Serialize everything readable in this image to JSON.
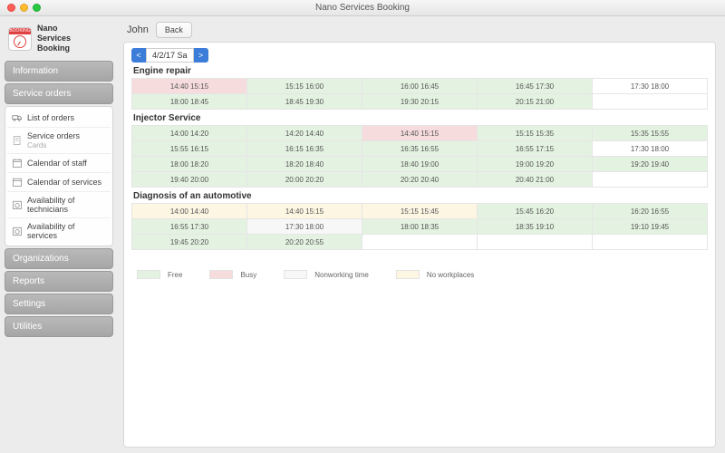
{
  "window": {
    "title": "Nano Services Booking"
  },
  "brand": {
    "line1": "Nano",
    "line2": "Services",
    "line3": "Booking",
    "logo_top": "BOOKING"
  },
  "sidebar": {
    "sections": [
      {
        "label": "Information"
      },
      {
        "label": "Service orders"
      },
      {
        "label": "Organizations"
      },
      {
        "label": "Reports"
      },
      {
        "label": "Settings"
      },
      {
        "label": "Utilities"
      }
    ],
    "sub": [
      {
        "label": "List of orders",
        "subtitle": ""
      },
      {
        "label": "Service orders",
        "subtitle": "Cards"
      },
      {
        "label": "Calendar of staff",
        "subtitle": ""
      },
      {
        "label": "Calendar of services",
        "subtitle": ""
      },
      {
        "label": "Availability of technicians",
        "subtitle": ""
      },
      {
        "label": "Availability of services",
        "subtitle": ""
      }
    ]
  },
  "header": {
    "name": "John",
    "back": "Back"
  },
  "datebar": {
    "prev": "<",
    "value": "4/2/17 Sa",
    "next": ">"
  },
  "groups": [
    {
      "title": "Engine repair",
      "rows": [
        [
          {
            "t": "14:40 15:15",
            "s": "busy"
          },
          {
            "t": "15:15 16:00",
            "s": "free"
          },
          {
            "t": "16:00 16:45",
            "s": "free"
          },
          {
            "t": "16:45 17:30",
            "s": "free"
          },
          {
            "t": "17:30 18:00",
            "s": "empty"
          }
        ],
        [
          {
            "t": "18:00 18:45",
            "s": "free"
          },
          {
            "t": "18:45 19:30",
            "s": "free"
          },
          {
            "t": "19:30 20:15",
            "s": "free"
          },
          {
            "t": "20:15 21:00",
            "s": "free"
          },
          {
            "t": "",
            "s": "empty"
          }
        ]
      ]
    },
    {
      "title": "Injector Service",
      "rows": [
        [
          {
            "t": "14:00 14:20",
            "s": "free"
          },
          {
            "t": "14:20 14:40",
            "s": "free"
          },
          {
            "t": "14:40 15:15",
            "s": "busy"
          },
          {
            "t": "15:15 15:35",
            "s": "free"
          },
          {
            "t": "15:35 15:55",
            "s": "free"
          }
        ],
        [
          {
            "t": "15:55 16:15",
            "s": "free"
          },
          {
            "t": "16:15 16:35",
            "s": "free"
          },
          {
            "t": "16:35 16:55",
            "s": "free"
          },
          {
            "t": "16:55 17:15",
            "s": "free"
          },
          {
            "t": "17:30 18:00",
            "s": "empty"
          }
        ],
        [
          {
            "t": "18:00 18:20",
            "s": "free"
          },
          {
            "t": "18:20 18:40",
            "s": "free"
          },
          {
            "t": "18:40 19:00",
            "s": "free"
          },
          {
            "t": "19:00 19:20",
            "s": "free"
          },
          {
            "t": "19:20 19:40",
            "s": "free"
          }
        ],
        [
          {
            "t": "19:40 20:00",
            "s": "free"
          },
          {
            "t": "20:00 20:20",
            "s": "free"
          },
          {
            "t": "20:20 20:40",
            "s": "free"
          },
          {
            "t": "20:40 21:00",
            "s": "free"
          },
          {
            "t": "",
            "s": "empty"
          }
        ]
      ]
    },
    {
      "title": "Diagnosis of an automotive",
      "rows": [
        [
          {
            "t": "14:00 14:40",
            "s": "nowp"
          },
          {
            "t": "14:40 15:15",
            "s": "nowp"
          },
          {
            "t": "15:15 15:45",
            "s": "nowp"
          },
          {
            "t": "15:45 16:20",
            "s": "free"
          },
          {
            "t": "16:20 16:55",
            "s": "free"
          }
        ],
        [
          {
            "t": "16:55 17:30",
            "s": "free"
          },
          {
            "t": "17:30 18:00",
            "s": "nonw"
          },
          {
            "t": "18:00 18:35",
            "s": "free"
          },
          {
            "t": "18:35 19:10",
            "s": "free"
          },
          {
            "t": "19:10 19:45",
            "s": "free"
          }
        ],
        [
          {
            "t": "19:45 20:20",
            "s": "free"
          },
          {
            "t": "20:20 20:55",
            "s": "free"
          },
          {
            "t": "",
            "s": "empty"
          },
          {
            "t": "",
            "s": "empty"
          },
          {
            "t": "",
            "s": "empty"
          }
        ]
      ]
    }
  ],
  "legend": [
    {
      "label": "Free",
      "cls": "free"
    },
    {
      "label": "Busy",
      "cls": "busy"
    },
    {
      "label": "Nonworking time",
      "cls": "nonw"
    },
    {
      "label": "No workplaces",
      "cls": "nowp"
    }
  ]
}
